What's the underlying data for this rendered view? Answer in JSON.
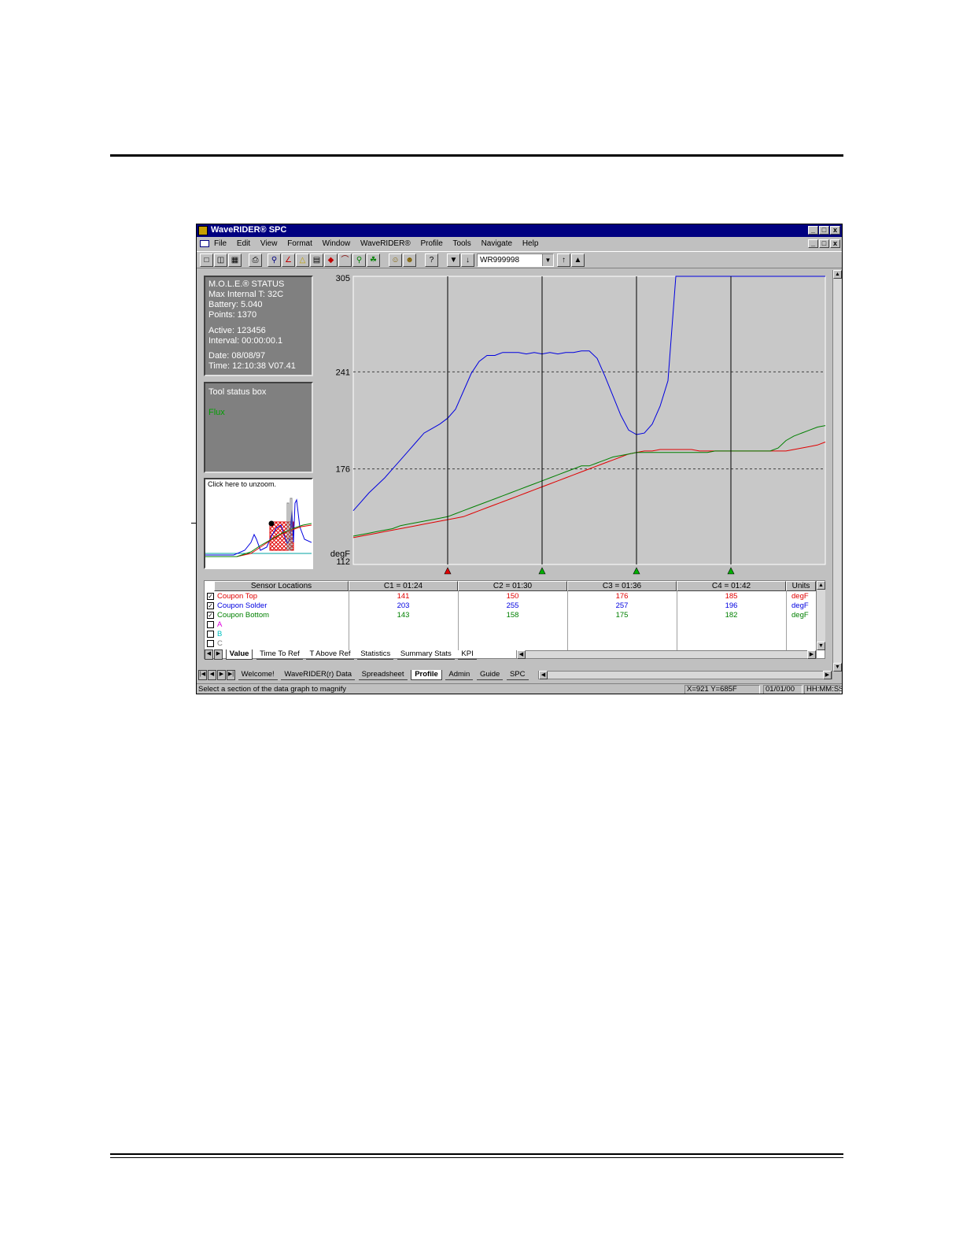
{
  "window": {
    "title": "WaveRIDER® SPC",
    "title_buttons": [
      "_",
      "□",
      "x"
    ]
  },
  "menu": [
    "File",
    "Edit",
    "View",
    "Format",
    "Window",
    "WaveRIDER®",
    "Profile",
    "Tools",
    "Navigate",
    "Help"
  ],
  "toolbar": {
    "combo_value": "WR999998"
  },
  "status_panel": {
    "title": "M.O.L.E.® STATUS",
    "max_internal": "Max Internal T: 32C",
    "battery": "Battery: 5.040",
    "points": "Points: 1370",
    "active": "Active: 123456",
    "interval": "Interval: 00:00:00.1",
    "date": "Date: 08/08/97",
    "time": "Time: 12:10:38  V07.41"
  },
  "tool_status": {
    "title": "Tool status box",
    "item": "Flux"
  },
  "mini_chart": {
    "caption": "Click here to unzoom."
  },
  "chart_data": {
    "type": "line",
    "xlabel": "",
    "ylabel": "degF",
    "ylim": [
      112,
      305
    ],
    "y_ticks": [
      305,
      241,
      176,
      112
    ],
    "ref_lines": [
      241,
      176
    ],
    "x": [
      0,
      10,
      20,
      30,
      40,
      50,
      60,
      70,
      80,
      90,
      100,
      110,
      120,
      130,
      140,
      150,
      160,
      170,
      180,
      190,
      200,
      210,
      220,
      230,
      240,
      250,
      260,
      270,
      280,
      290,
      300,
      310,
      320,
      330,
      340,
      350,
      360,
      370,
      380,
      390,
      400,
      410,
      420,
      430,
      440,
      450,
      460,
      470,
      480,
      490,
      500,
      510,
      520,
      530,
      540,
      550,
      560,
      570,
      580,
      590,
      600
    ],
    "series": [
      {
        "name": "Coupon Top",
        "color": "#e00000",
        "values": [
          130,
          131,
          132,
          133,
          134,
          135,
          136,
          137,
          138,
          139,
          140,
          141,
          142,
          143,
          144,
          146,
          148,
          150,
          152,
          154,
          156,
          158,
          160,
          162,
          164,
          166,
          168,
          170,
          172,
          174,
          176,
          178,
          180,
          182,
          184,
          186,
          187,
          188,
          188,
          189,
          189,
          189,
          189,
          189,
          188,
          188,
          188,
          188,
          188,
          188,
          188,
          188,
          188,
          188,
          188,
          188,
          189,
          190,
          191,
          192,
          194
        ]
      },
      {
        "name": "Coupon Solder",
        "color": "#0000e0",
        "values": [
          148,
          154,
          160,
          165,
          170,
          176,
          182,
          188,
          194,
          200,
          203,
          206,
          210,
          216,
          228,
          240,
          248,
          252,
          252,
          254,
          254,
          254,
          253,
          254,
          253,
          254,
          253,
          254,
          254,
          255,
          255,
          250,
          238,
          225,
          212,
          202,
          199,
          200,
          206,
          218,
          235,
          305,
          305,
          305,
          305,
          305,
          305,
          305,
          305,
          305,
          305,
          305,
          305,
          305,
          305,
          305,
          305,
          305,
          305,
          305,
          305
        ]
      },
      {
        "name": "Coupon Bottom",
        "color": "#008000",
        "values": [
          131,
          132,
          133,
          134,
          135,
          136,
          138,
          139,
          140,
          141,
          142,
          143,
          144,
          146,
          148,
          150,
          152,
          154,
          156,
          158,
          160,
          162,
          164,
          166,
          168,
          170,
          172,
          174,
          176,
          178,
          178,
          180,
          182,
          184,
          185,
          186,
          187,
          187,
          187,
          187,
          187,
          187,
          187,
          187,
          187,
          187,
          188,
          188,
          188,
          188,
          188,
          188,
          188,
          188,
          190,
          195,
          198,
          200,
          202,
          204,
          205
        ]
      }
    ],
    "cursors": [
      {
        "label": "C1 = 01:24",
        "x": 120,
        "color": "#e00000"
      },
      {
        "label": "C2 = 01:30",
        "x": 240,
        "color": "#00b000"
      },
      {
        "label": "C3 = 01:36",
        "x": 360,
        "color": "#00b000"
      },
      {
        "label": "C4 = 01:42",
        "x": 480,
        "color": "#00b000"
      }
    ]
  },
  "grid": {
    "header": [
      "Sensor Locations",
      "C1 = 01:24",
      "C2 = 01:30",
      "C3 = 01:36",
      "C4 = 01:42",
      "Units"
    ],
    "rows": [
      {
        "checked": true,
        "label": "Coupon Top",
        "color": "#e00000",
        "values": [
          "141",
          "150",
          "176",
          "185"
        ],
        "unit": "degF"
      },
      {
        "checked": true,
        "label": "Coupon Solder",
        "color": "#0000e0",
        "values": [
          "203",
          "255",
          "257",
          "196"
        ],
        "unit": "degF"
      },
      {
        "checked": true,
        "label": "Coupon Bottom",
        "color": "#008000",
        "values": [
          "143",
          "158",
          "175",
          "182"
        ],
        "unit": "degF"
      },
      {
        "checked": false,
        "label": "A",
        "color": "#e000e0",
        "values": [
          "",
          "",
          "",
          ""
        ],
        "unit": ""
      },
      {
        "checked": false,
        "label": "B",
        "color": "#00c0c0",
        "values": [
          "",
          "",
          "",
          ""
        ],
        "unit": ""
      },
      {
        "checked": false,
        "label": "C",
        "color": "#808080",
        "values": [
          "",
          "",
          "",
          ""
        ],
        "unit": ""
      }
    ]
  },
  "inner_tabs": [
    "Value",
    "Time To Ref",
    "T Above Ref",
    "Statistics",
    "Summary Stats",
    "KPI"
  ],
  "outer_tabs": [
    "Welcome!",
    "WaveRIDER(r) Data",
    "Spreadsheet",
    "Profile",
    "Admin",
    "Guide",
    "SPC"
  ],
  "statusbar": {
    "message": "Select a section of the data graph to magnify",
    "coords": "X=921 Y=685F",
    "date": "01/01/00",
    "time_fmt": "HH:MM:SS"
  }
}
